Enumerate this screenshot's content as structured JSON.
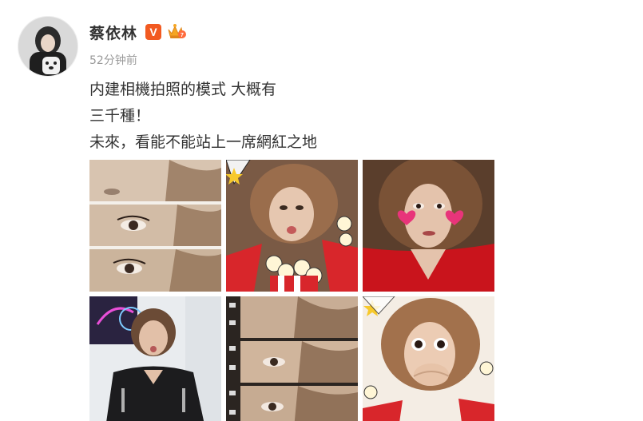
{
  "post": {
    "author": {
      "name": "蔡依林",
      "verified_mark": "V",
      "vip_icon": "vip-crown-icon",
      "avatar_icon": "avatar-photo"
    },
    "timestamp": "52分钟前",
    "text_lines": [
      "内建相機拍照的模式 大概有",
      "三千種！",
      "未來，看能不能站上一席網紅之地"
    ],
    "photos": [
      {
        "name": "photo-eyes-triptych-bw",
        "style": "warm-sepia"
      },
      {
        "name": "photo-pout-popcorn-frame",
        "style": "popcorn-comic"
      },
      {
        "name": "photo-heart-cheeks-red",
        "style": "red-hearts"
      },
      {
        "name": "photo-selfie-neon",
        "style": "neon-dark"
      },
      {
        "name": "photo-film-strip-eyes",
        "style": "film-strip"
      },
      {
        "name": "photo-surprised-popcorn-frame",
        "style": "popcorn-comic"
      }
    ],
    "colors": {
      "verified_orange": "#f25a21",
      "vip_gold": "#f5a623",
      "text_primary": "#333333",
      "text_muted": "#9a9a9a"
    }
  }
}
